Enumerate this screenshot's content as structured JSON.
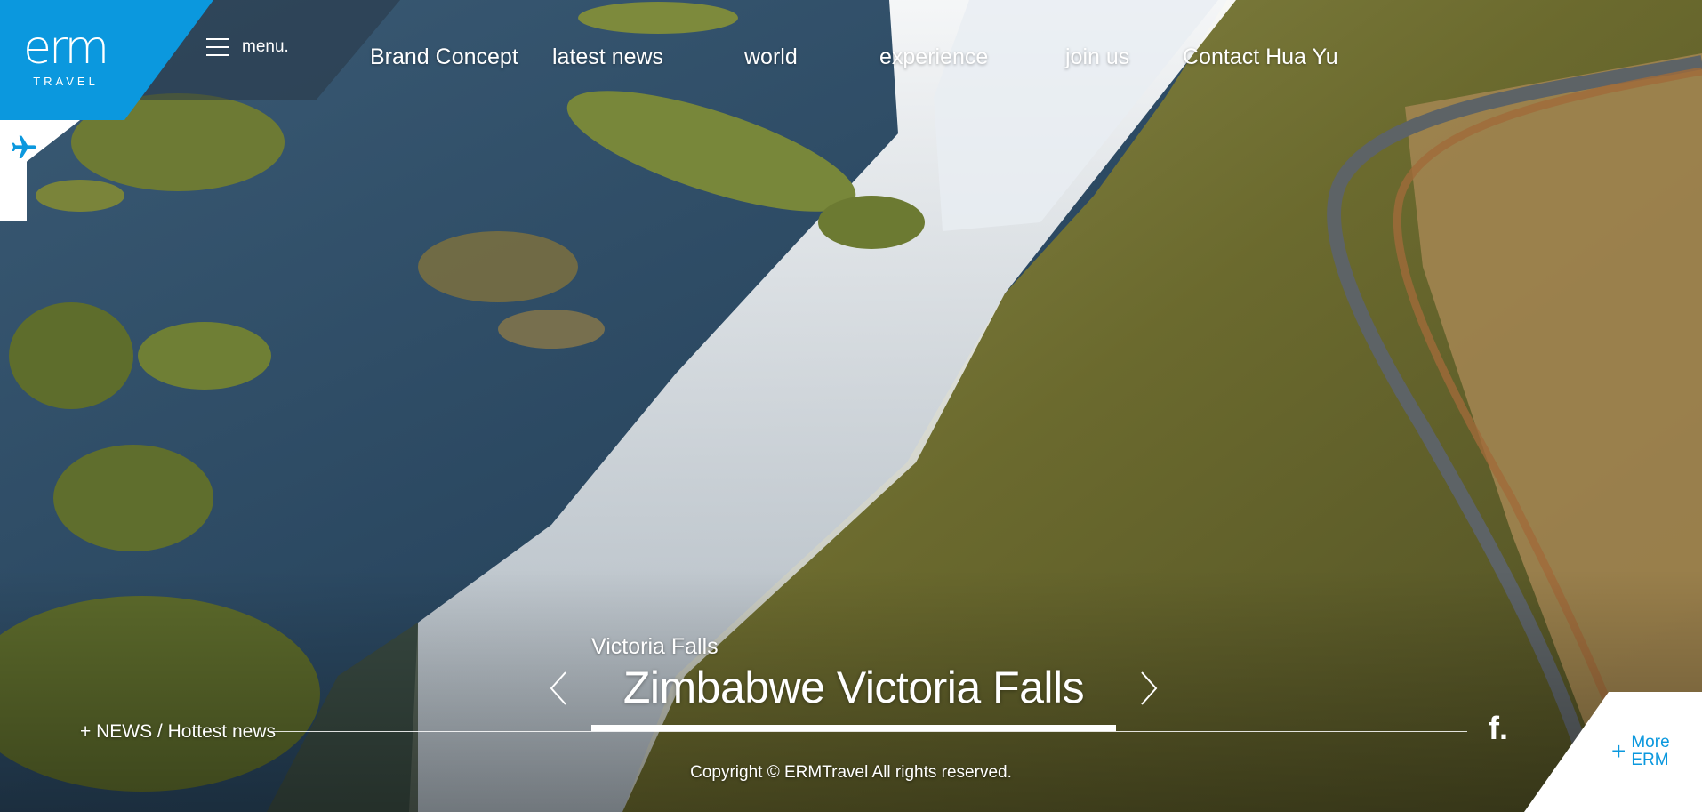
{
  "brand": {
    "logo_text": "erm",
    "logo_sub": "TRAVEL",
    "color": "#0b98de"
  },
  "menu": {
    "label": "menu."
  },
  "nav": {
    "items": [
      {
        "label": "Brand Concept"
      },
      {
        "label": "latest news"
      },
      {
        "label": "world"
      },
      {
        "label": "experience"
      },
      {
        "label": "join us"
      },
      {
        "label": "Contact Hua Yu"
      }
    ]
  },
  "side": {
    "icon": "airplane-icon"
  },
  "slide": {
    "subtitle": "Victoria Falls",
    "title": "Zimbabwe Victoria Falls",
    "prev_icon": "chevron-left-icon",
    "next_icon": "chevron-right-icon"
  },
  "news": {
    "label": "+ NEWS / Hottest news"
  },
  "social": {
    "label": "f."
  },
  "footer": {
    "copyright": "Copyright © ERMTravel All rights reserved."
  },
  "more": {
    "plus": "+",
    "label": "More ERM"
  }
}
